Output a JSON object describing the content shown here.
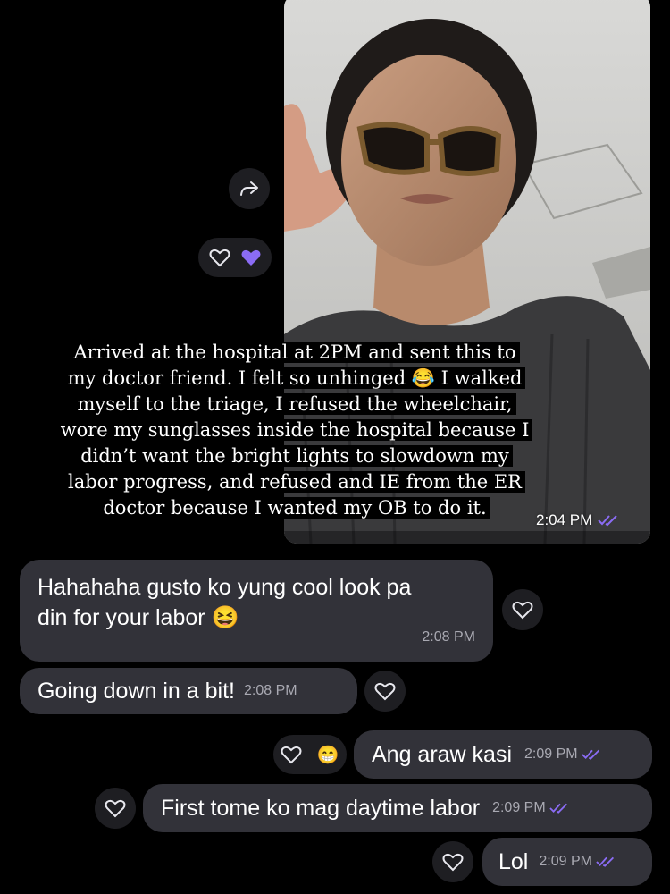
{
  "photo_message": {
    "caption_lines": [
      "Arrived at the hospital at 2PM and sent this to",
      "my doctor friend. I felt so unhinged 😂 I walked",
      "myself to the triage, I refused the wheelchair,",
      "wore my sunglasses inside the hospital because I",
      "didn’t want the bright lights to slowdown my",
      "labor progress, and refused and IE from the ER",
      "doctor because I wanted my OB to do it."
    ],
    "time": "2:04 PM"
  },
  "messages": [
    {
      "text_line1": "Hahahaha gusto ko yung cool look pa",
      "text_line2": "din for your labor 😆",
      "time": "2:08 PM",
      "direction": "incoming"
    },
    {
      "text": "Going down in a bit!",
      "time": "2:08 PM",
      "direction": "incoming"
    },
    {
      "text": "Ang araw kasi",
      "time": "2:09 PM",
      "direction": "outgoing",
      "reaction": "😁"
    },
    {
      "text": "First tome ko mag daytime labor",
      "time": "2:09 PM",
      "direction": "outgoing"
    },
    {
      "text": "Lol",
      "time": "2:09 PM",
      "direction": "outgoing"
    }
  ],
  "icons": {
    "share": "share-arrow-icon",
    "heart_outline": "heart-outline-icon",
    "heart_filled": "heart-filled-icon",
    "read_ticks": "double-check-icon"
  },
  "colors": {
    "background": "#000000",
    "bubble": "#323239",
    "accent": "#8b6cf5",
    "time_text": "#a9a9b2"
  }
}
